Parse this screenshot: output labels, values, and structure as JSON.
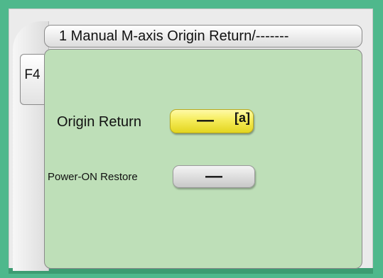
{
  "title": "1 Manual M-axis Origin Return/-------",
  "function_tab": "F4",
  "rows": [
    {
      "label": "Origin Return",
      "value": "—",
      "note": "[a]",
      "color": "#f5ec5a"
    },
    {
      "label": "Power-ON Restore",
      "value": "—",
      "color": "#dcdcdc"
    }
  ],
  "colors": {
    "background": "#4fb88c",
    "panel": "#bedfb8"
  }
}
